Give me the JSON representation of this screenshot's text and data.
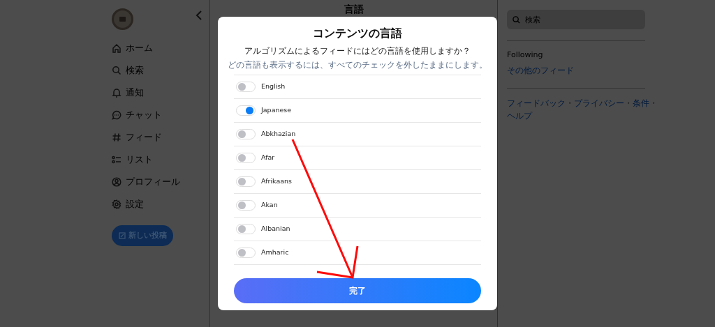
{
  "sidebar": {
    "items": [
      {
        "kind": "home",
        "label": "ホーム"
      },
      {
        "kind": "search",
        "label": "検索"
      },
      {
        "kind": "bell",
        "label": "通知"
      },
      {
        "kind": "chat",
        "label": "チャット"
      },
      {
        "kind": "hash",
        "label": "フィード"
      },
      {
        "kind": "list",
        "label": "リスト"
      },
      {
        "kind": "profile",
        "label": "プロフィール"
      },
      {
        "kind": "gear",
        "label": "設定"
      }
    ],
    "new_post_button": "新しい投稿"
  },
  "header": {
    "title": "言語"
  },
  "right_panel": {
    "search": {
      "placeholder": "検索"
    },
    "following": "Following",
    "more_feeds": "その他のフィード",
    "footer_items": [
      {
        "kind": "link",
        "text": "フィードバック"
      },
      {
        "kind": "separator",
        "text": "・"
      },
      {
        "kind": "link",
        "text": "プライバシー"
      },
      {
        "kind": "separator",
        "text": "・"
      },
      {
        "kind": "link",
        "text": "条件"
      },
      {
        "kind": "separator",
        "text": "・"
      },
      {
        "kind": "link",
        "text": "ヘルプ"
      }
    ]
  },
  "dialog": {
    "title": "コンテンツの言語",
    "question": "アルゴリズムによるフィードにはどの言語を使用しますか？",
    "hint": "どの言語も表示するには、すべてのチェックを外したままにします。",
    "languages": [
      {
        "name": "English",
        "on": false
      },
      {
        "name": "Japanese",
        "on": true
      },
      {
        "name": "Abkhazian",
        "on": false
      },
      {
        "name": "Afar",
        "on": false
      },
      {
        "name": "Afrikaans",
        "on": false
      },
      {
        "name": "Akan",
        "on": false
      },
      {
        "name": "Albanian",
        "on": false
      },
      {
        "name": "Amharic",
        "on": false
      }
    ],
    "done_button": "完了"
  }
}
